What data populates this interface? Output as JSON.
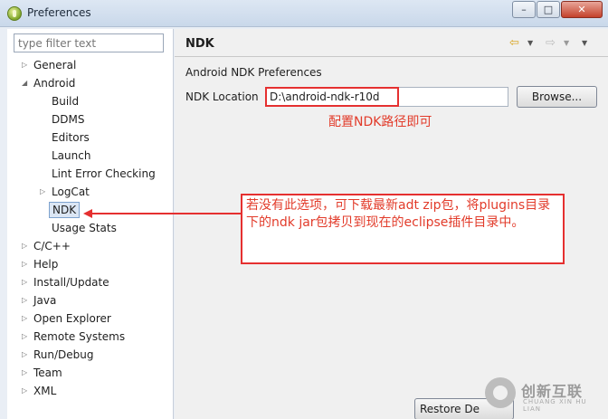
{
  "window": {
    "title": "Preferences",
    "buttons": {
      "minimize": "–",
      "maximize": "□",
      "close": "✕"
    }
  },
  "filter": {
    "placeholder": "type filter text"
  },
  "tree": {
    "items": [
      {
        "label": "General",
        "level": 0,
        "state": "collapsed"
      },
      {
        "label": "Android",
        "level": 0,
        "state": "expanded"
      },
      {
        "label": "Build",
        "level": 1,
        "state": "leaf"
      },
      {
        "label": "DDMS",
        "level": 1,
        "state": "leaf"
      },
      {
        "label": "Editors",
        "level": 1,
        "state": "leaf"
      },
      {
        "label": "Launch",
        "level": 1,
        "state": "leaf"
      },
      {
        "label": "Lint Error Checking",
        "level": 1,
        "state": "leaf"
      },
      {
        "label": "LogCat",
        "level": 1,
        "state": "collapsed"
      },
      {
        "label": "NDK",
        "level": 1,
        "state": "leaf",
        "selected": true
      },
      {
        "label": "Usage Stats",
        "level": 1,
        "state": "leaf"
      },
      {
        "label": "C/C++",
        "level": 0,
        "state": "collapsed"
      },
      {
        "label": "Help",
        "level": 0,
        "state": "collapsed"
      },
      {
        "label": "Install/Update",
        "level": 0,
        "state": "collapsed"
      },
      {
        "label": "Java",
        "level": 0,
        "state": "collapsed"
      },
      {
        "label": "Open Explorer",
        "level": 0,
        "state": "collapsed"
      },
      {
        "label": "Remote Systems",
        "level": 0,
        "state": "collapsed"
      },
      {
        "label": "Run/Debug",
        "level": 0,
        "state": "collapsed"
      },
      {
        "label": "Team",
        "level": 0,
        "state": "collapsed"
      },
      {
        "label": "XML",
        "level": 0,
        "state": "collapsed"
      }
    ]
  },
  "page": {
    "title": "NDK",
    "section": "Android NDK Preferences",
    "ndk_location_label": "NDK Location",
    "ndk_location_value": "D:\\android-ndk-r10d",
    "browse_label": "Browse...",
    "restore_label": "Restore De",
    "nav_icons": [
      "back-arrow-icon",
      "dropdown-icon",
      "forward-arrow-icon",
      "dropdown-icon",
      "view-menu-icon"
    ]
  },
  "annotations": {
    "path_note": "配置NDK路径即可",
    "callout": "若没有此选项，可下载最新adt zip包，将plugins目录下的ndk jar包拷贝到现在的eclipse插件目录中。",
    "color": "#e53030"
  },
  "watermark": {
    "text": "创新互联",
    "sub": "CHUANG XIN HU LIAN"
  },
  "colors": {
    "accent": "#e53030",
    "selection": "#dbe6f4"
  }
}
